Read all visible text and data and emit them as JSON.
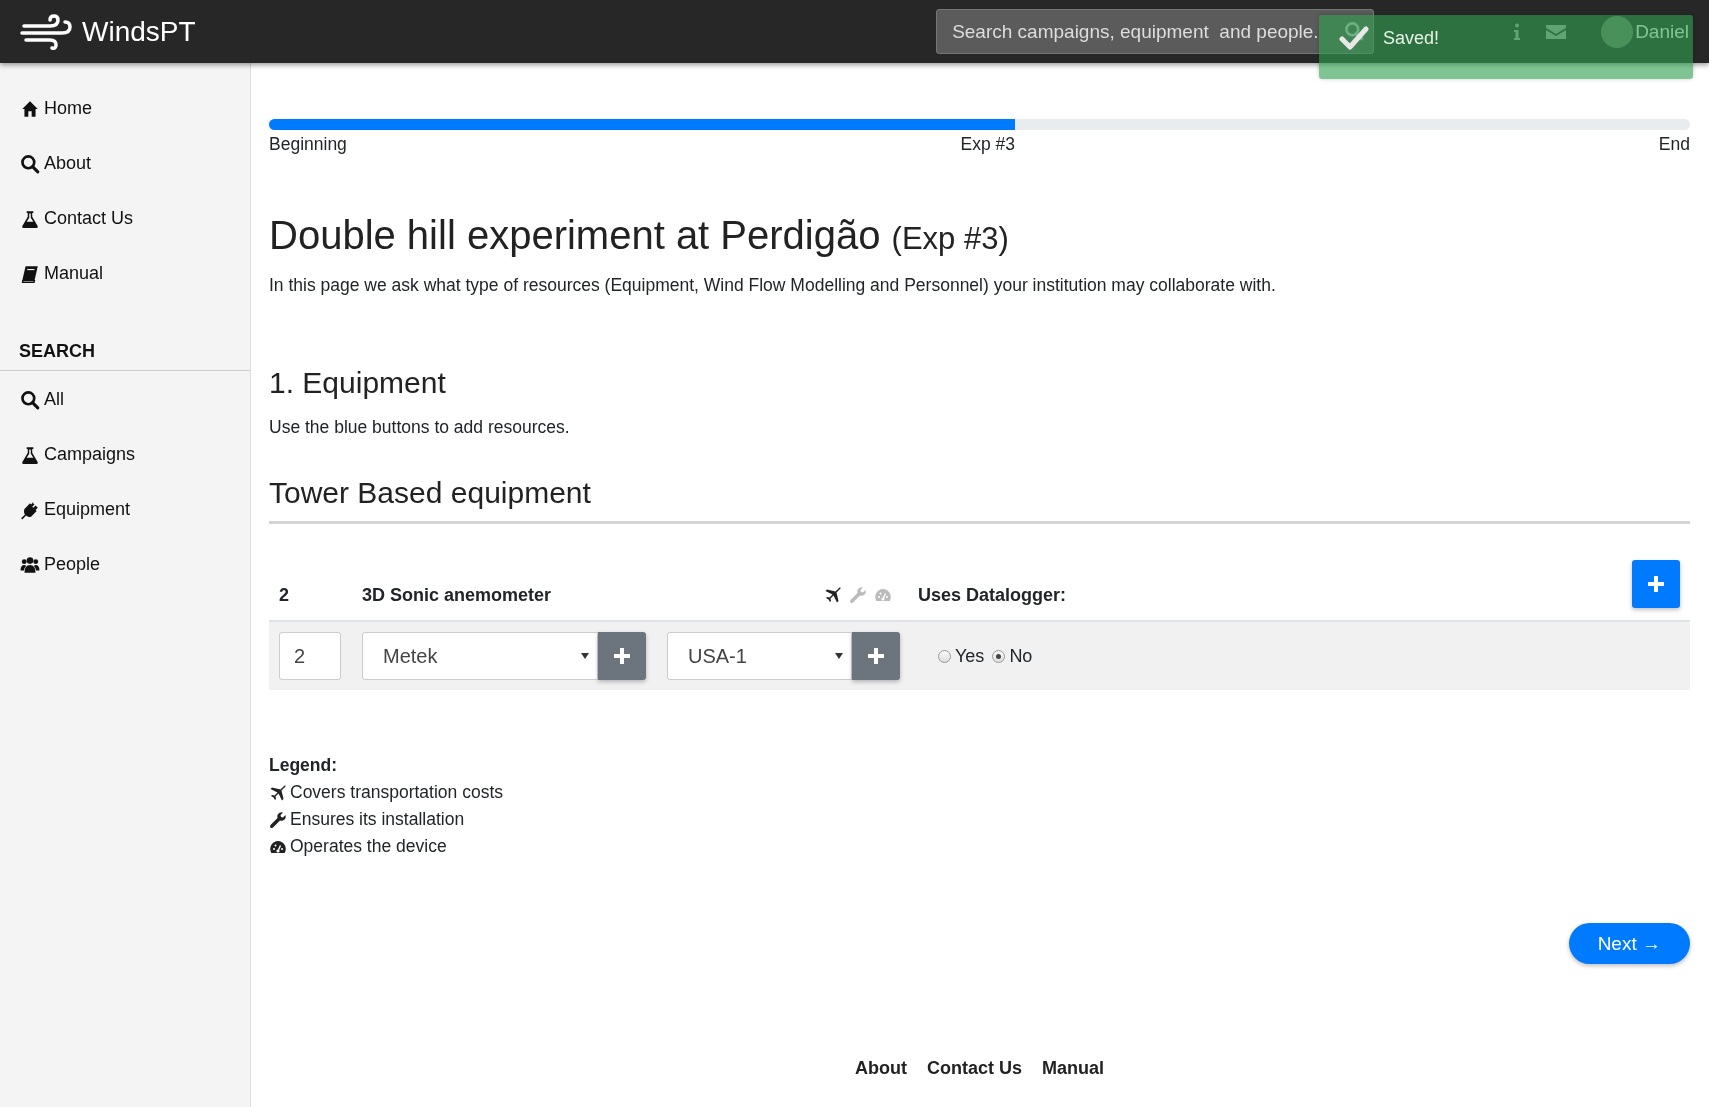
{
  "header": {
    "brand": "WindsPT",
    "search": {
      "placeholder": "Search campaigns, equipment  and people."
    },
    "user": {
      "name": "Daniel"
    }
  },
  "toast": {
    "message": "Saved!"
  },
  "sidebar": {
    "items": [
      {
        "label": "Home",
        "kind": "home"
      },
      {
        "label": "About",
        "kind": "search"
      },
      {
        "label": "Contact Us",
        "kind": "flask"
      },
      {
        "label": "Manual",
        "kind": "book"
      }
    ],
    "search_section": {
      "heading": "SEARCH",
      "items": [
        {
          "label": "All",
          "kind": "search"
        },
        {
          "label": "Campaigns",
          "kind": "flask"
        },
        {
          "label": "Equipment",
          "kind": "plug"
        },
        {
          "label": "People",
          "kind": "users"
        }
      ]
    }
  },
  "progress": {
    "level": 0.525,
    "start_label": "Beginning",
    "current_label": "Exp #3",
    "end_label": "End"
  },
  "page": {
    "title": "Double hill experiment at Perdigão",
    "title_suffix": "(Exp #3)",
    "intro": "In this page we ask what type of resources (Equipment, Wind Flow Modelling and Personnel) your institution may collaborate with."
  },
  "section": {
    "heading": "1. Equipment",
    "instruction": "Use the blue buttons to add resources.",
    "subsection": "Tower Based equipment"
  },
  "equipment": {
    "header": {
      "count": "2",
      "name": "3D Sonic anemometer",
      "flags": [
        {
          "kind": "transport",
          "on": true
        },
        {
          "kind": "installation",
          "on": false
        },
        {
          "kind": "operation",
          "on": false
        }
      ],
      "datalogger_label": "Uses Datalogger:"
    },
    "row": {
      "quantity": "2",
      "manufacturer": "Metek",
      "model": "USA-1",
      "datalogger": [
        {
          "label": "Yes",
          "selected": false
        },
        {
          "label": "No",
          "selected": true
        }
      ]
    }
  },
  "legend": {
    "title": "Legend:",
    "items": [
      {
        "kind": "transport",
        "text": "Covers transportation costs"
      },
      {
        "kind": "installation",
        "text": "Ensures its installation"
      },
      {
        "kind": "operation",
        "text": "Operates the device"
      }
    ]
  },
  "next_button": {
    "label": "Next →"
  },
  "footer": {
    "links": [
      "About",
      "Contact Us",
      "Manual"
    ]
  }
}
